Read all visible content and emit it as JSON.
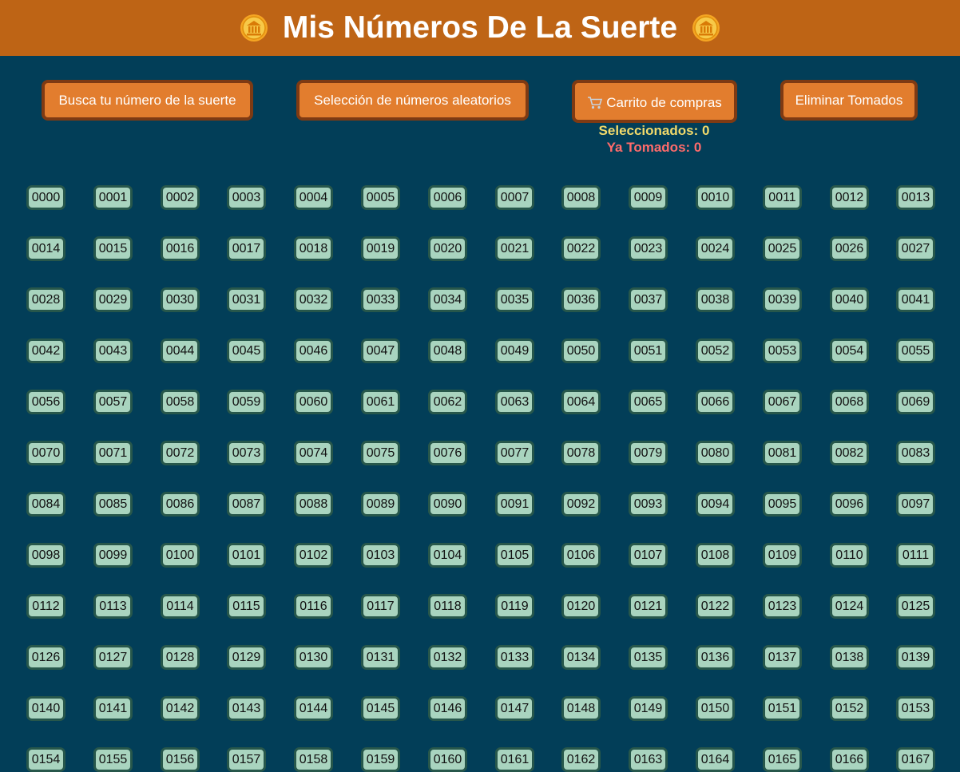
{
  "header": {
    "title": "Mis Números De La Suerte",
    "left_icon": "bank-icon",
    "right_icon": "bank-icon"
  },
  "actions": {
    "search_label": "Busca tu número de la suerte",
    "random_label": "Selección de números aleatorios",
    "cart_label": "Carrito de compras",
    "cart_icon": "shopping-cart-icon",
    "remove_label": "Eliminar Tomados"
  },
  "counters": {
    "selected": "Seleccionados: 0",
    "taken": "Ya Tomados: 0"
  },
  "colors": {
    "header_bg": "#be6415",
    "page_bg": "#023e58",
    "button_bg": "#e27d2e",
    "button_border": "#7e3a13",
    "number_bg": "#a9d4bf",
    "number_border": "#27574b",
    "selected_text": "#f2da6b",
    "taken_text": "#ff6b6b"
  },
  "numbers": [
    "0000",
    "0001",
    "0002",
    "0003",
    "0004",
    "0005",
    "0006",
    "0007",
    "0008",
    "0009",
    "0010",
    "0011",
    "0012",
    "0013",
    "0014",
    "0015",
    "0016",
    "0017",
    "0018",
    "0019",
    "0020",
    "0021",
    "0022",
    "0023",
    "0024",
    "0025",
    "0026",
    "0027",
    "0028",
    "0029",
    "0030",
    "0031",
    "0032",
    "0033",
    "0034",
    "0035",
    "0036",
    "0037",
    "0038",
    "0039",
    "0040",
    "0041",
    "0042",
    "0043",
    "0044",
    "0045",
    "0046",
    "0047",
    "0048",
    "0049",
    "0050",
    "0051",
    "0052",
    "0053",
    "0054",
    "0055",
    "0056",
    "0057",
    "0058",
    "0059",
    "0060",
    "0061",
    "0062",
    "0063",
    "0064",
    "0065",
    "0066",
    "0067",
    "0068",
    "0069",
    "0070",
    "0071",
    "0072",
    "0073",
    "0074",
    "0075",
    "0076",
    "0077",
    "0078",
    "0079",
    "0080",
    "0081",
    "0082",
    "0083",
    "0084",
    "0085",
    "0086",
    "0087",
    "0088",
    "0089",
    "0090",
    "0091",
    "0092",
    "0093",
    "0094",
    "0095",
    "0096",
    "0097",
    "0098",
    "0099",
    "0100",
    "0101",
    "0102",
    "0103",
    "0104",
    "0105",
    "0106",
    "0107",
    "0108",
    "0109",
    "0110",
    "0111",
    "0112",
    "0113",
    "0114",
    "0115",
    "0116",
    "0117",
    "0118",
    "0119",
    "0120",
    "0121",
    "0122",
    "0123",
    "0124",
    "0125",
    "0126",
    "0127",
    "0128",
    "0129",
    "0130",
    "0131",
    "0132",
    "0133",
    "0134",
    "0135",
    "0136",
    "0137",
    "0138",
    "0139",
    "0140",
    "0141",
    "0142",
    "0143",
    "0144",
    "0145",
    "0146",
    "0147",
    "0148",
    "0149",
    "0150",
    "0151",
    "0152",
    "0153",
    "0154",
    "0155",
    "0156",
    "0157",
    "0158",
    "0159",
    "0160",
    "0161",
    "0162",
    "0163",
    "0164",
    "0165",
    "0166",
    "0167"
  ]
}
